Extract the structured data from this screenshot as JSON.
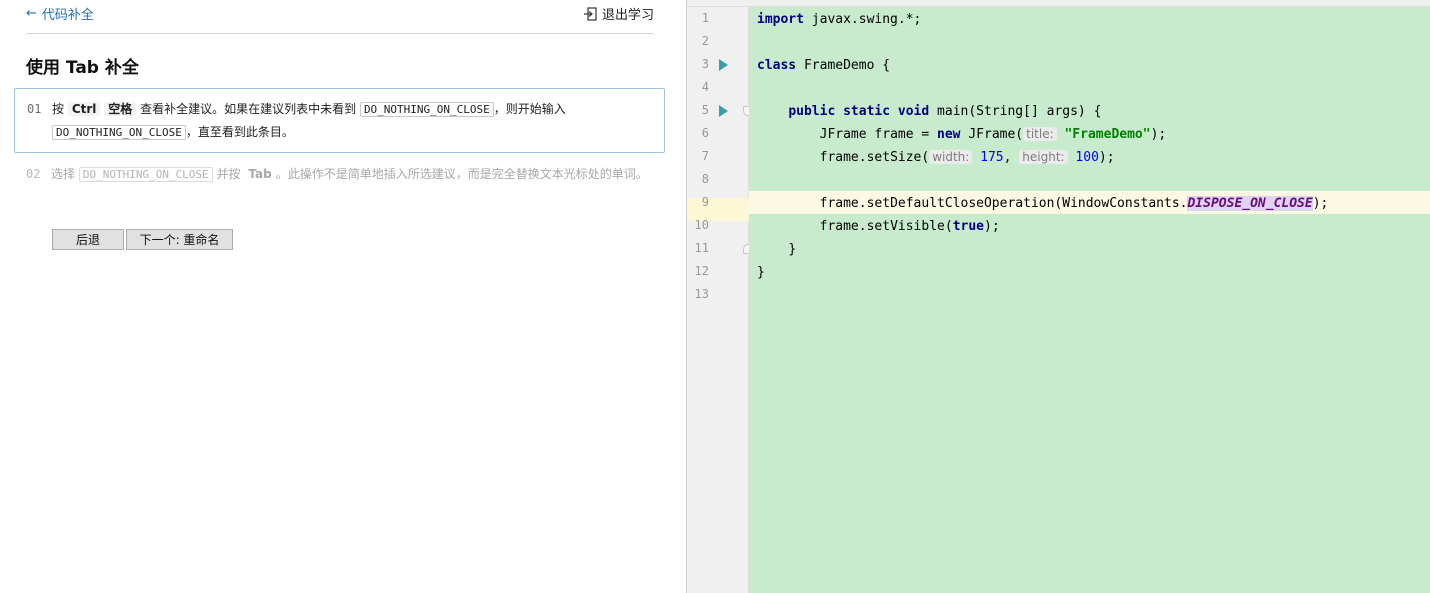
{
  "nav": {
    "back_label": "代码补全",
    "exit_label": "退出学习"
  },
  "lesson": {
    "title": "使用 Tab 补全",
    "step1": {
      "number": "01",
      "t1": "按",
      "key1": "Ctrl",
      "key2": "空格",
      "t2": "查看补全建议。如果在建议列表中未看到",
      "code1": "DO_NOTHING_ON_CLOSE",
      "t3": "，则开始输入",
      "code2": "DO_NOTHING_ON_CLOSE",
      "t4": "，直至看到此条目。"
    },
    "step2": {
      "number": "02",
      "t1": "选择",
      "code1": "DO_NOTHING_ON_CLOSE",
      "t2": "并按",
      "key1": "Tab",
      "t3": "。此操作不是简单地插入所选建议，而是完全替换文本光标处的单词。"
    },
    "buttons": {
      "prev": "后退",
      "next": "下一个: 重命名"
    }
  },
  "editor": {
    "line_numbers": [
      "1",
      "2",
      "3",
      "4",
      "5",
      "6",
      "7",
      "8",
      "9",
      "10",
      "11",
      "12",
      "13"
    ],
    "code": {
      "l1_kw": "import",
      "l1_rest": " javax.swing.*;",
      "l3_kw": "class",
      "l3_rest": " FrameDemo {",
      "l5_kw1": "public",
      "l5_kw2": "static",
      "l5_kw3": "void",
      "l5_rest": " main(String[] args) {",
      "l6_a": "JFrame frame = ",
      "l6_kw": "new",
      "l6_b": " JFrame(",
      "l6_hint": "title:",
      "l6_str": "\"FrameDemo\"",
      "l6_c": ");",
      "l7_a": "frame.setSize(",
      "l7_hint1": "width:",
      "l7_n1": "175",
      "l7_b": ", ",
      "l7_hint2": "height:",
      "l7_n2": "100",
      "l7_c": ");",
      "l9_a": "frame.setDefaultCloseOperation(WindowConstants.",
      "l9_const": "DISPOSE_ON_CLOSE",
      "l9_b": ");",
      "l10_a": "frame.setVisible(",
      "l10_kw": "true",
      "l10_b": ");",
      "l11": "}",
      "l12": "}"
    }
  }
}
